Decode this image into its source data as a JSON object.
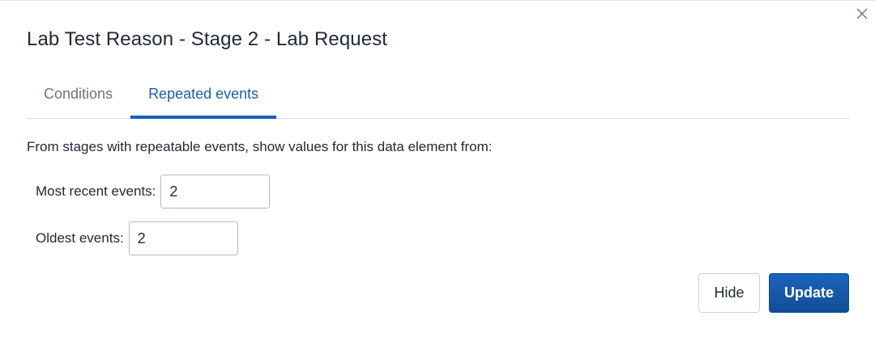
{
  "dialog": {
    "title": "Lab Test Reason - Stage 2 - Lab Request",
    "close_icon": "close-icon"
  },
  "tabs": [
    {
      "label": "Conditions",
      "active": false
    },
    {
      "label": "Repeated events",
      "active": true
    }
  ],
  "repeated_events": {
    "description": "From stages with repeatable events, show values for this data element from:",
    "most_recent": {
      "label": "Most recent events:",
      "value": "2"
    },
    "oldest": {
      "label": "Oldest events:",
      "value": "2"
    }
  },
  "actions": {
    "hide_label": "Hide",
    "update_label": "Update"
  },
  "colors": {
    "accent": "#1660b8",
    "tab_inactive": "#6b7480",
    "text": "#212934"
  }
}
